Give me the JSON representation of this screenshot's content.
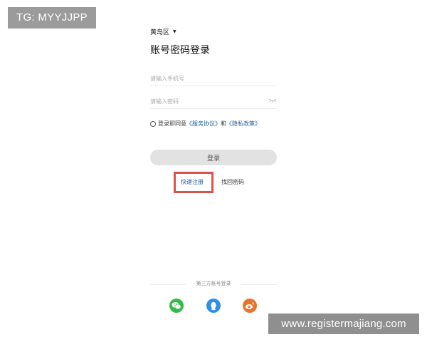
{
  "watermarks": {
    "top": "TG: MYYJJPP",
    "bottom": "www.registermajiang.com"
  },
  "region": {
    "label": "黄岛区",
    "caret": "▼"
  },
  "title": "账号密码登录",
  "phone": {
    "placeholder": "请输入手机号",
    "value": ""
  },
  "password": {
    "placeholder": "请输入密码",
    "value": "",
    "toggle_icon": "eye-closed-icon"
  },
  "agreement": {
    "prefix": "登录即同意",
    "service": "《服务协议》",
    "and": "和",
    "privacy": "《隐私政策》"
  },
  "login_button": "登录",
  "links": {
    "register": "快速注册",
    "forgot": "找回密码"
  },
  "third_party": {
    "label": "第三方账号登录",
    "icons": [
      "wechat-icon",
      "qq-icon",
      "weibo-icon"
    ]
  },
  "colors": {
    "link": "#1f5b9c",
    "highlight": "#d9534f",
    "wechat": "#36b84a",
    "qq": "#2e8fe8",
    "weibo": "#e8742c"
  }
}
